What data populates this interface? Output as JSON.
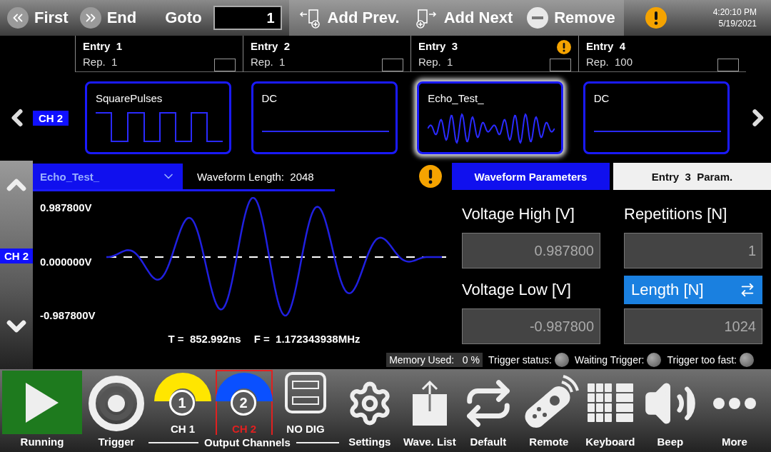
{
  "toolbar": {
    "buttons": [
      {
        "kind": "first",
        "label": "First"
      },
      {
        "kind": "end",
        "label": "End"
      }
    ],
    "goto": {
      "label": "Goto",
      "value": "1"
    },
    "actions": [
      {
        "kind": "add_prev",
        "label": "Add Prev."
      },
      {
        "kind": "add_next",
        "label": "Add Next"
      },
      {
        "kind": "remove",
        "label": "Remove"
      }
    ],
    "warning": true,
    "time": "4:20:10 PM",
    "date": "5/19/2021"
  },
  "channel": "CH 2",
  "entries": [
    {
      "title": "Entry  1",
      "rep": "Rep.  1",
      "checked": false,
      "warning": false,
      "waveform": "SquarePulses",
      "kind": "square",
      "selected": false
    },
    {
      "title": "Entry  2",
      "rep": "Rep.  1",
      "checked": false,
      "warning": false,
      "waveform": "DC",
      "kind": "dc",
      "selected": false
    },
    {
      "title": "Entry  3",
      "rep": "Rep.  1",
      "checked": false,
      "warning": true,
      "waveform": "Echo_Test_",
      "kind": "echo",
      "selected": true
    },
    {
      "title": "Entry  4",
      "rep": "Rep.  100",
      "checked": false,
      "warning": false,
      "waveform": "DC",
      "kind": "dc",
      "selected": false
    }
  ],
  "editor": {
    "channel": "CH 2",
    "waveform": "Echo_Test_",
    "length_label": "Waveform Length:",
    "length": "2048",
    "warning": true,
    "y_labels": [
      "0.987800V",
      "0.000000V",
      "-0.987800V"
    ],
    "period": "T =  852.992ns",
    "frequency": "F =  1.172343938MHz"
  },
  "params": {
    "tabs": [
      {
        "label": "Waveform Parameters",
        "selected": true
      },
      {
        "label": "Entry  3  Param.",
        "selected": false
      }
    ],
    "fields": [
      {
        "label": "Voltage High [V]",
        "value": "0.987800",
        "selected": false
      },
      {
        "label": "Repetitions [N]",
        "value": "1",
        "selected": false
      },
      {
        "label": "Voltage Low [V]",
        "value": "-0.987800",
        "selected": false
      },
      {
        "label": "Length [N]",
        "value": "1024",
        "selected": true
      }
    ]
  },
  "status": {
    "memory_label": "Memory Used:",
    "memory_value": "0 %",
    "indicators": [
      {
        "label": "Trigger status:",
        "on": false
      },
      {
        "label": "Waiting Trigger:",
        "on": false
      },
      {
        "label": "Trigger too fast:",
        "on": false
      }
    ]
  },
  "bottom": {
    "group_label": "Output Channels",
    "items": [
      {
        "kind": "play",
        "label": "Running"
      },
      {
        "kind": "trigger",
        "label": "Trigger"
      },
      {
        "kind": "channel",
        "number": "1",
        "label": "CH 1",
        "color": "#ffe600",
        "selected": false
      },
      {
        "kind": "channel",
        "number": "2",
        "label": "CH 2",
        "color": "#0a50ff",
        "selected": true
      },
      {
        "kind": "dig",
        "label": "NO DIG"
      },
      {
        "kind": "settings",
        "label": "Settings"
      },
      {
        "kind": "upload",
        "label": "Wave. List"
      },
      {
        "kind": "repeat",
        "label": "Default"
      },
      {
        "kind": "remote",
        "label": "Remote"
      },
      {
        "kind": "keyboard",
        "label": "Keyboard"
      },
      {
        "kind": "beep",
        "label": "Beep"
      },
      {
        "kind": "more",
        "label": "More"
      }
    ]
  }
}
